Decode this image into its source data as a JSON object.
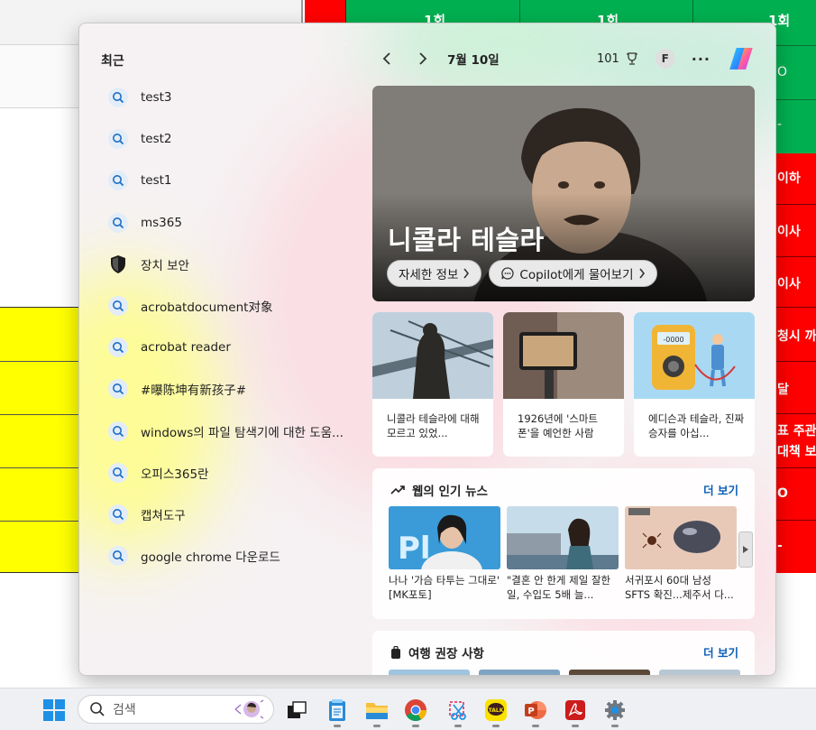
{
  "background_sheet": {
    "headers": [
      "1회",
      "1회",
      "1회"
    ],
    "right_column": [
      "O",
      "-",
      "이하",
      "이사",
      "이사",
      "청시 까",
      "달",
      "표 주관",
      "대책 보",
      "O",
      "-"
    ]
  },
  "recent": {
    "title": "최근",
    "items": [
      {
        "label": "test3",
        "icon": "search-icon"
      },
      {
        "label": "test2",
        "icon": "search-icon"
      },
      {
        "label": "test1",
        "icon": "search-icon"
      },
      {
        "label": "ms365",
        "icon": "search-icon"
      },
      {
        "label": "장치 보안",
        "icon": "shield-icon"
      },
      {
        "label": "acrobatdocument对象",
        "icon": "search-icon"
      },
      {
        "label": "acrobat reader",
        "icon": "search-icon"
      },
      {
        "label": "#曝陈坤有新孩子#",
        "icon": "search-icon"
      },
      {
        "label": "windows의 파일 탐색기에 대한 도움...",
        "icon": "search-icon"
      },
      {
        "label": "오피스365란",
        "icon": "search-icon"
      },
      {
        "label": "캡쳐도구",
        "icon": "search-icon"
      },
      {
        "label": "google chrome 다운로드",
        "icon": "search-icon"
      }
    ]
  },
  "topbar": {
    "date": "7월 10일",
    "points": "101",
    "avatar_initial": "F",
    "more": "···"
  },
  "hero": {
    "title": "니콜라 테슬라",
    "btn_more": "자세한 정보",
    "btn_copilot": "Copilot에게 물어보기"
  },
  "cards": [
    {
      "text": "니콜라 테슬라에 대해 모르고 있었..."
    },
    {
      "text": "1926년에 '스마트폰'을 예언한 사람"
    },
    {
      "text": "에디슨과 테슬라, 진짜 승자를 아십..."
    }
  ],
  "news": {
    "title": "웹의 인기 뉴스",
    "more": "더 보기",
    "items": [
      {
        "caption": "나나 '가슴 타투는 그대로' [MK포토]"
      },
      {
        "caption": "\"결혼 안 한게 제일 잘한 일, 수입도 5배 늘..."
      },
      {
        "caption": "서귀포시 60대 남성 SFTS 확진...제주서 다..."
      }
    ]
  },
  "travel": {
    "title": "여행 권장 사항",
    "more": "더 보기"
  },
  "taskbar": {
    "search_placeholder": "검색",
    "apps": [
      "task-view-icon",
      "notepad-icon",
      "file-explorer-icon",
      "chrome-icon",
      "snipping-tool-icon",
      "kakaotalk-icon",
      "powerpoint-icon",
      "acrobat-icon",
      "settings-icon"
    ]
  },
  "colors": {
    "accent": "#0a5fb4",
    "sheet_green": "#00b050",
    "sheet_red": "#ff0000",
    "sheet_yellow": "#ffff00"
  }
}
